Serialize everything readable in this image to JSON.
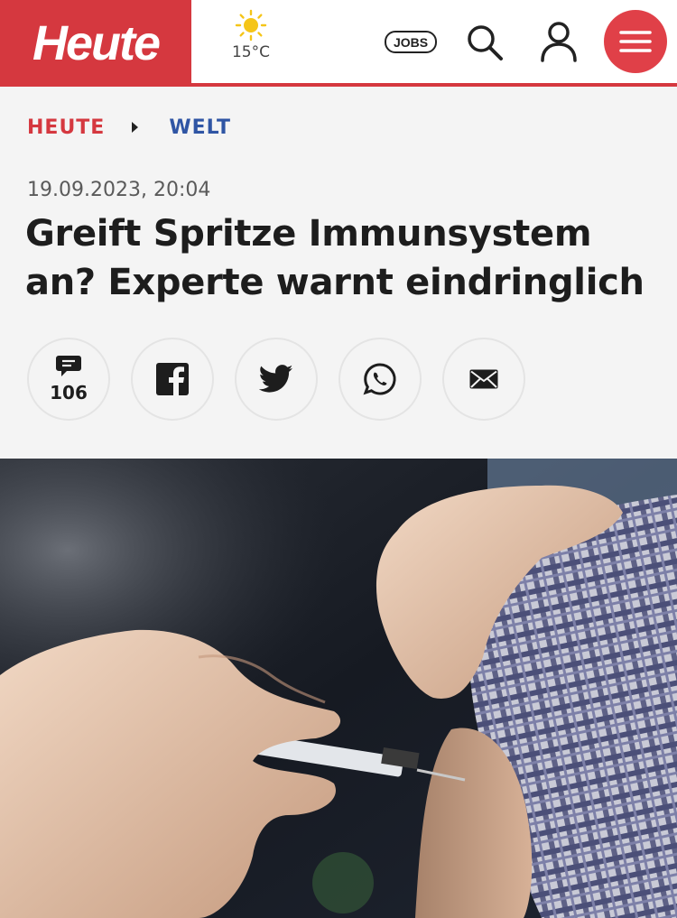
{
  "header": {
    "logo_text": "Heute",
    "weather": {
      "icon": "sun-icon",
      "temperature": "15°C"
    },
    "jobs_label": "JOBS",
    "search_icon": "search-icon",
    "account_icon": "user-icon",
    "menu_icon": "hamburger-menu-icon",
    "colors": {
      "brand_red": "#d5383f",
      "menu_red": "#e04048",
      "section_blue": "#2f55a4"
    }
  },
  "breadcrumb": {
    "home": "HEUTE",
    "section": "WELT"
  },
  "article": {
    "date": "19.09.2023, 20:04",
    "headline": "Greift Spritze Immunsystem an? Experte warnt eindringlich"
  },
  "share": {
    "comments_icon": "comment-icon",
    "comments_count": "106",
    "buttons": [
      "facebook-icon",
      "twitter-icon",
      "whatsapp-icon",
      "email-icon"
    ]
  },
  "photo": {
    "subject": "vaccination-injection-photo"
  }
}
